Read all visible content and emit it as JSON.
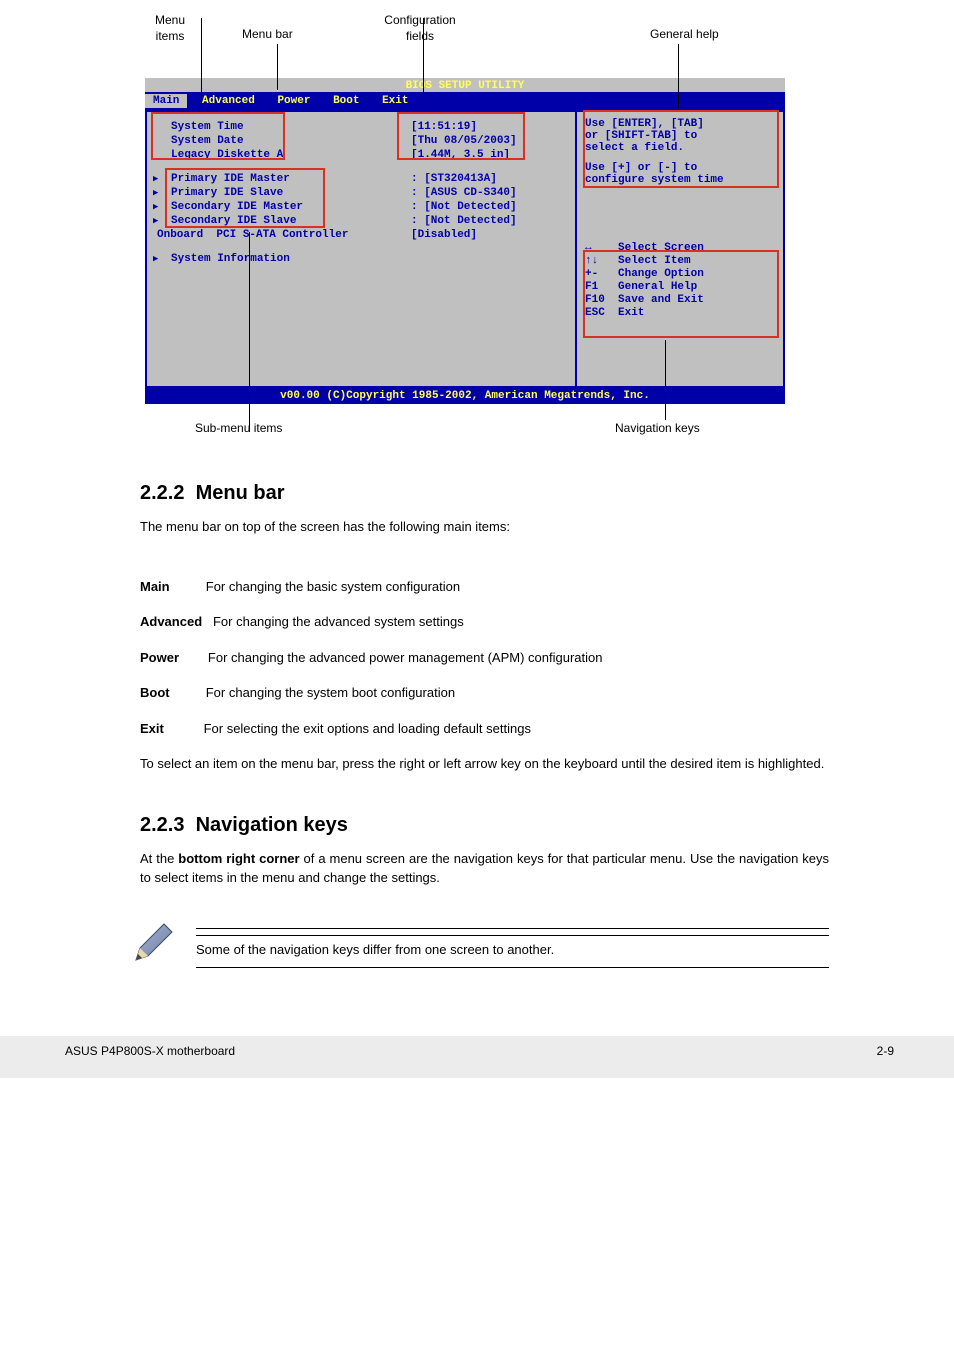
{
  "section_number": "2.2.2",
  "section_title": "Menu bar",
  "intro": "The menu bar on top of the screen has the following main items:",
  "callouts": {
    "menu_items": "Menu items",
    "menu_bar": "Menu bar",
    "config_fields": "Configuration fields",
    "general_help": "General help",
    "submenu_items": "Sub-menu items",
    "nav_keys": "Navigation keys"
  },
  "bios": {
    "title": "BIOS SETUP UTILITY",
    "tabs": {
      "main": "Main",
      "advanced": "Advanced",
      "power": "Power",
      "boot": "Boot",
      "exit": "Exit"
    },
    "rows": {
      "system_time": {
        "label": "System Time",
        "value": "[11:51:19]"
      },
      "system_date": {
        "label": "System Date",
        "value": "[Thu 08/05/2003]"
      },
      "legacy_diskette": {
        "label": "Legacy Diskette A",
        "value": "[1.44M, 3.5 in]"
      },
      "primary_master": {
        "label": "Primary IDE Master",
        "value": ": [ST320413A]"
      },
      "primary_slave": {
        "label": "Primary IDE Slave",
        "value": ": [ASUS CD-S340]"
      },
      "secondary_master": {
        "label": "Secondary IDE Master",
        "value": ": [Not Detected]"
      },
      "secondary_slave": {
        "label": "Secondary IDE Slave",
        "value": ": [Not Detected]"
      },
      "sata_controller": {
        "label": "Onboard  PCI S-ATA Controller",
        "value": "[Disabled]"
      },
      "system_info": {
        "label": "System Information"
      }
    },
    "help": {
      "line1": "Use [ENTER], [TAB]",
      "line2": "or [SHIFT-TAB] to",
      "line3": "select a field.",
      "line4": "Use [+] or [-] to",
      "line5": "configure system time"
    },
    "navkeys": {
      "k1": "↔    Select Screen",
      "k2": "↑↓   Select Item",
      "k3": "+-   Change Option",
      "k4": "F1   General Help",
      "k5": "F10  Save and Exit",
      "k6": "ESC  Exit"
    },
    "footer": "v00.00 (C)Copyright 1985-2002, American Megatrends, Inc."
  },
  "menubar_items": {
    "main": {
      "title": "Main",
      "desc": "For changing the basic system configuration"
    },
    "advanced": {
      "title": "Advanced",
      "desc": "For changing the advanced system settings"
    },
    "power": {
      "title": "Power",
      "desc": "For changing the advanced power management (APM) configuration"
    },
    "boot": {
      "title": "Boot",
      "desc": "For changing the system boot configuration"
    },
    "exit": {
      "title": "Exit",
      "desc": "For selecting the exit options and loading default settings"
    }
  },
  "menubar_para": "To select an item on the menu bar, press the right or left arrow key on the keyboard until the desired item is highlighted.",
  "section2_number": "2.2.3",
  "section2_title": "Navigation keys",
  "navkeys_para1": "At the ",
  "navkeys_spec": "bottom right corner",
  "navkeys_para2": " of a menu screen are the navigation keys for that particular menu. Use the navigation keys to select items in the menu and change the settings.",
  "note": "Some of the navigation keys differ from one screen to another.",
  "footer": {
    "left": "ASUS P4P800S-X motherboard",
    "right": "2-9"
  }
}
